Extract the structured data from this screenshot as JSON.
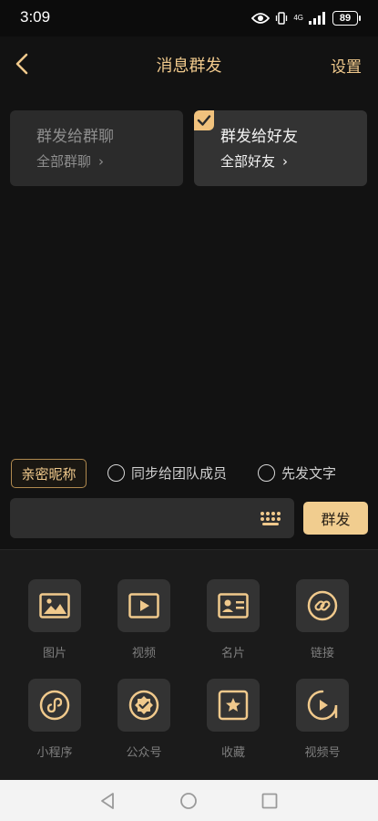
{
  "status_bar": {
    "time": "3:09",
    "network": "4G",
    "battery": "89"
  },
  "header": {
    "title": "消息群发",
    "settings_label": "设置"
  },
  "cards": [
    {
      "title": "群发给群聊",
      "subtitle": "全部群聊",
      "selected": false
    },
    {
      "title": "群发给好友",
      "subtitle": "全部好友",
      "selected": true
    }
  ],
  "options": {
    "nickname_label": "亲密昵称",
    "sync_team_label": "同步给团队成员",
    "send_text_first_label": "先发文字"
  },
  "composer": {
    "input_value": "",
    "send_label": "群发"
  },
  "tools": [
    {
      "label": "图片",
      "icon": "image-icon"
    },
    {
      "label": "视频",
      "icon": "video-icon"
    },
    {
      "label": "名片",
      "icon": "contact-card-icon"
    },
    {
      "label": "链接",
      "icon": "link-icon"
    },
    {
      "label": "小程序",
      "icon": "mini-program-icon"
    },
    {
      "label": "公众号",
      "icon": "official-account-icon"
    },
    {
      "label": "收藏",
      "icon": "favorites-icon"
    },
    {
      "label": "视频号",
      "icon": "channels-icon"
    }
  ],
  "colors": {
    "accent": "#f0c98c",
    "background": "#121212",
    "panel": "#1b1b1b"
  }
}
